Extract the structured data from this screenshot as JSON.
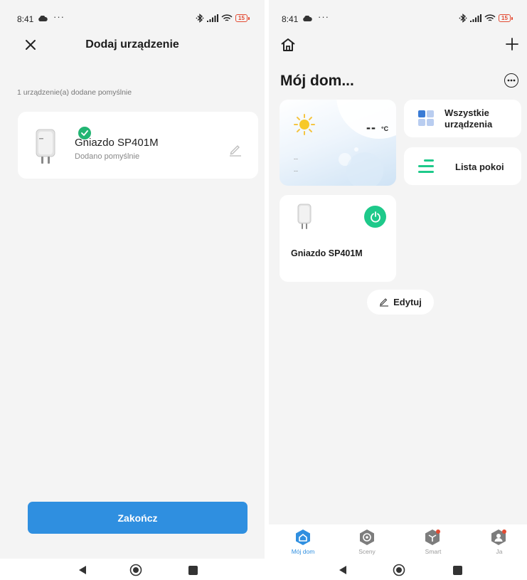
{
  "status_bar": {
    "time": "8:41",
    "dots": "···",
    "battery": "15"
  },
  "left_screen": {
    "title": "Dodaj urządzenie",
    "success_message": "1 urządzenie(a) dodane pomyślnie",
    "device": {
      "name": "Gniazdo SP401M",
      "status": "Dodano pomyślnie"
    },
    "finish_button": "Zakończ"
  },
  "right_screen": {
    "home_title": "Mój dom...",
    "weather": {
      "temperature": "--",
      "unit": "°C",
      "line1": "--",
      "line2": "--"
    },
    "tiles": {
      "all_devices": "Wszystkie urządzenia",
      "room_list": "Lista pokoi"
    },
    "device_card": {
      "name": "Gniazdo SP401M"
    },
    "edit_button": "Edytuj",
    "tabs": [
      {
        "label": "Mój dom",
        "active": true
      },
      {
        "label": "Sceny",
        "active": false
      },
      {
        "label": "Smart",
        "active": false
      },
      {
        "label": "Ja",
        "active": false
      }
    ]
  },
  "colors": {
    "accent": "#2f8fe0",
    "success": "#22b573",
    "power": "#1ec98a",
    "battery": "#e34b33"
  }
}
